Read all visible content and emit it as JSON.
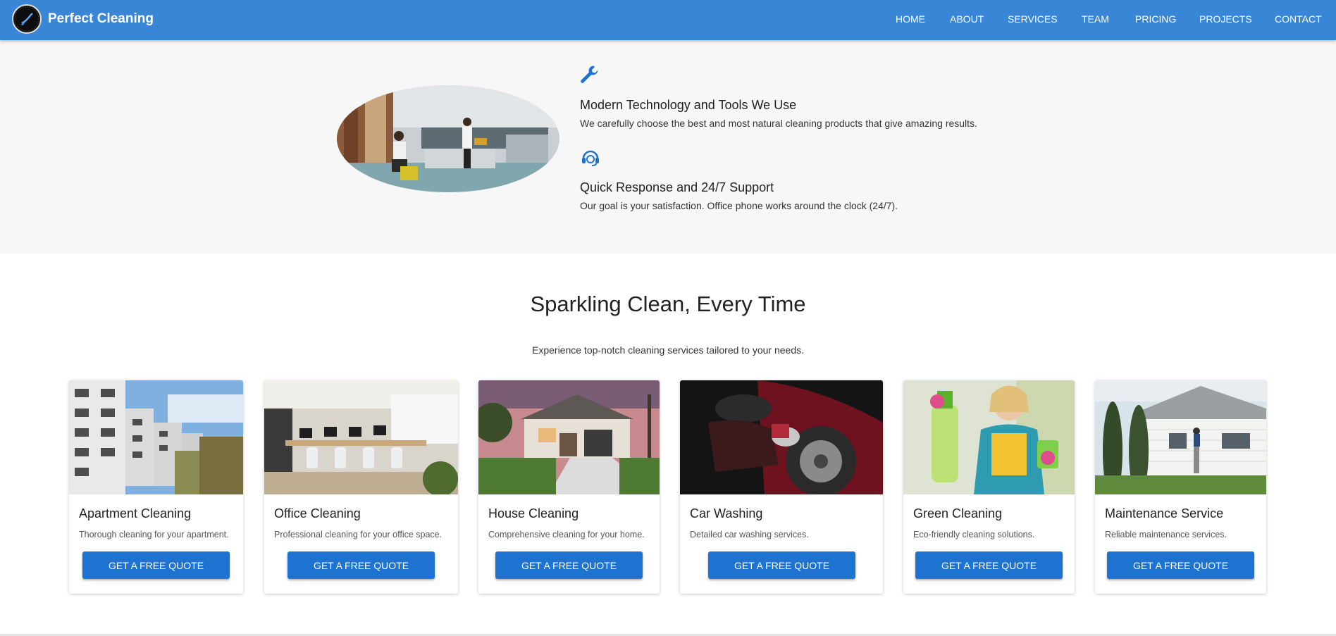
{
  "header": {
    "brand": "Perfect Cleaning",
    "nav": [
      "HOME",
      "ABOUT",
      "SERVICES",
      "TEAM",
      "PRICING",
      "PROJECTS",
      "CONTACT"
    ]
  },
  "features": {
    "items": [
      {
        "icon": "wrench-icon",
        "title": "Modern Technology and Tools We Use",
        "text": "We carefully choose the best and most natural cleaning products that give amazing results."
      },
      {
        "icon": "support-headset-icon",
        "title": "Quick Response and 24/7 Support",
        "text": "Our goal is your satisfaction. Office phone works around the clock (24/7)."
      }
    ]
  },
  "services": {
    "title": "Sparkling Clean, Every Time",
    "subtitle": "Experience top-notch cleaning services tailored to your needs.",
    "cards": [
      {
        "title": "Apartment Cleaning",
        "desc": "Thorough cleaning for your apartment.",
        "button": "GET A FREE QUOTE"
      },
      {
        "title": "Office Cleaning",
        "desc": "Professional cleaning for your office space.",
        "button": "GET A FREE QUOTE"
      },
      {
        "title": "House Cleaning",
        "desc": "Comprehensive cleaning for your home.",
        "button": "GET A FREE QUOTE"
      },
      {
        "title": "Car Washing",
        "desc": "Detailed car washing services.",
        "button": "GET A FREE QUOTE"
      },
      {
        "title": "Green Cleaning",
        "desc": "Eco-friendly cleaning solutions.",
        "button": "GET A FREE QUOTE"
      },
      {
        "title": "Maintenance Service",
        "desc": "Reliable maintenance services.",
        "button": "GET A FREE QUOTE"
      }
    ]
  },
  "colors": {
    "nav_bg": "#3a86d6",
    "accent": "#1e73d0",
    "feature_bg": "#f7f7f7"
  }
}
